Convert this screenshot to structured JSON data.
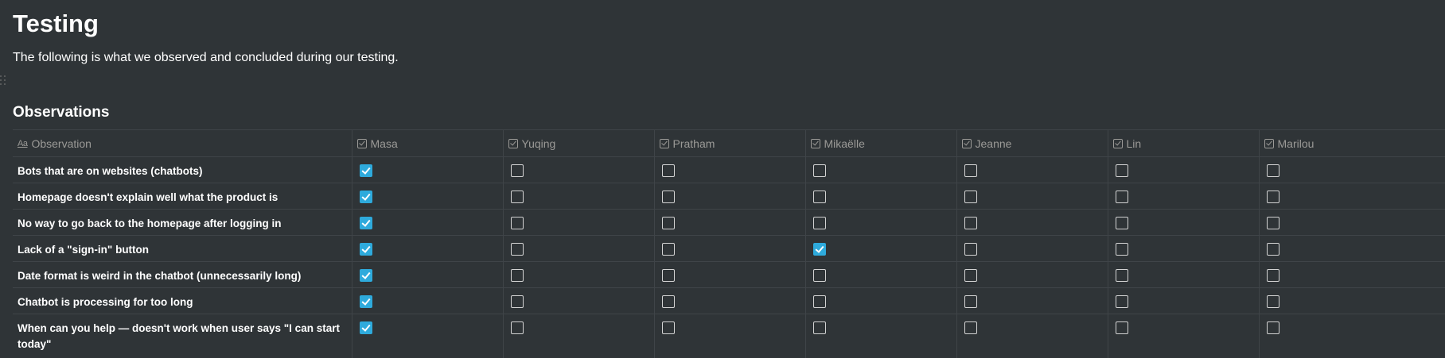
{
  "page": {
    "title": "Testing",
    "description": "The following is what we observed and concluded during our testing."
  },
  "section": {
    "title": "Observations"
  },
  "table": {
    "columns": [
      {
        "label": "Observation",
        "icon": "text-property-icon"
      },
      {
        "label": "Masa",
        "icon": "checkbox-property-icon"
      },
      {
        "label": "Yuqing",
        "icon": "checkbox-property-icon"
      },
      {
        "label": "Pratham",
        "icon": "checkbox-property-icon"
      },
      {
        "label": "Mikaëlle",
        "icon": "checkbox-property-icon"
      },
      {
        "label": "Jeanne",
        "icon": "checkbox-property-icon"
      },
      {
        "label": "Lin",
        "icon": "checkbox-property-icon"
      },
      {
        "label": "Marilou",
        "icon": "checkbox-property-icon"
      }
    ],
    "rows": [
      {
        "observation": "Bots that are on websites (chatbots)",
        "checks": [
          true,
          false,
          false,
          false,
          false,
          false,
          false
        ]
      },
      {
        "observation": "Homepage doesn't explain well what the product is",
        "checks": [
          true,
          false,
          false,
          false,
          false,
          false,
          false
        ]
      },
      {
        "observation": "No way to go back to the homepage after logging in",
        "checks": [
          true,
          false,
          false,
          false,
          false,
          false,
          false
        ]
      },
      {
        "observation": "Lack of a \"sign-in\" button",
        "checks": [
          true,
          false,
          false,
          true,
          false,
          false,
          false
        ]
      },
      {
        "observation": "Date format is weird in the chatbot (unnecessarily long)",
        "checks": [
          true,
          false,
          false,
          false,
          false,
          false,
          false
        ]
      },
      {
        "observation": "Chatbot is processing for too long",
        "checks": [
          true,
          false,
          false,
          false,
          false,
          false,
          false
        ]
      },
      {
        "observation": "When can you help — doesn't work when user says \"I can start today\"",
        "checks": [
          true,
          false,
          false,
          false,
          false,
          false,
          false
        ]
      }
    ]
  },
  "colors": {
    "background": "#2f3437",
    "checked": "#2eaadc",
    "border": "#3f4448",
    "muted_text": "#9b9a97"
  }
}
